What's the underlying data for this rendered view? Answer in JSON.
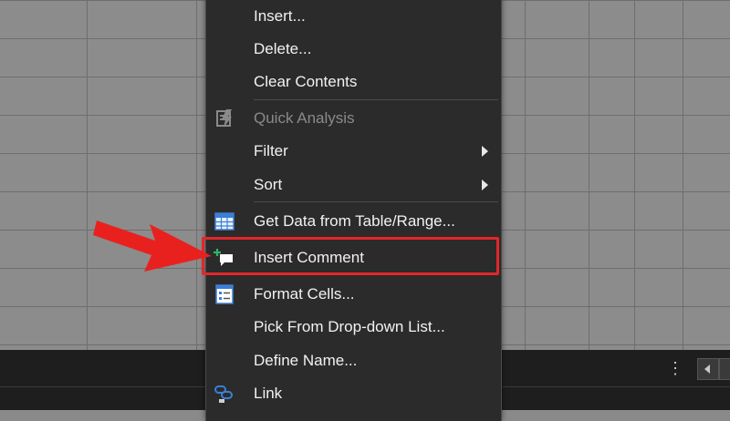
{
  "context_menu": {
    "items": [
      {
        "label": "Insert...",
        "disabled": false
      },
      {
        "label": "Delete...",
        "disabled": false
      },
      {
        "label": "Clear Contents",
        "disabled": false
      },
      {
        "label": "Quick Analysis",
        "disabled": true,
        "icon": "quick-analysis-icon"
      },
      {
        "label": "Filter",
        "disabled": false,
        "submenu": true
      },
      {
        "label": "Sort",
        "disabled": false,
        "submenu": true
      },
      {
        "label": "Get Data from Table/Range...",
        "disabled": false,
        "icon": "table-icon"
      },
      {
        "label": "Insert Comment",
        "disabled": false,
        "icon": "insert-comment-icon",
        "highlighted": true
      },
      {
        "label": "Format Cells...",
        "disabled": false,
        "icon": "format-cells-icon"
      },
      {
        "label": "Pick From Drop-down List...",
        "disabled": false
      },
      {
        "label": "Define Name...",
        "disabled": false
      },
      {
        "label": "Link",
        "disabled": false,
        "icon": "link-icon"
      }
    ]
  },
  "colors": {
    "menu_background": "#2b2b2b",
    "menu_text": "#f2f2f2",
    "disabled_text": "#8a8a8a",
    "highlight_red": "#e3262b",
    "grid_background": "#8c8c8c"
  },
  "annotation": {
    "arrow_color": "#e8211f",
    "points_to": "Insert Comment"
  },
  "sheet_bar": {
    "more_icon": "more-vertical-icon",
    "scroll_left_icon": "scroll-left-icon"
  }
}
